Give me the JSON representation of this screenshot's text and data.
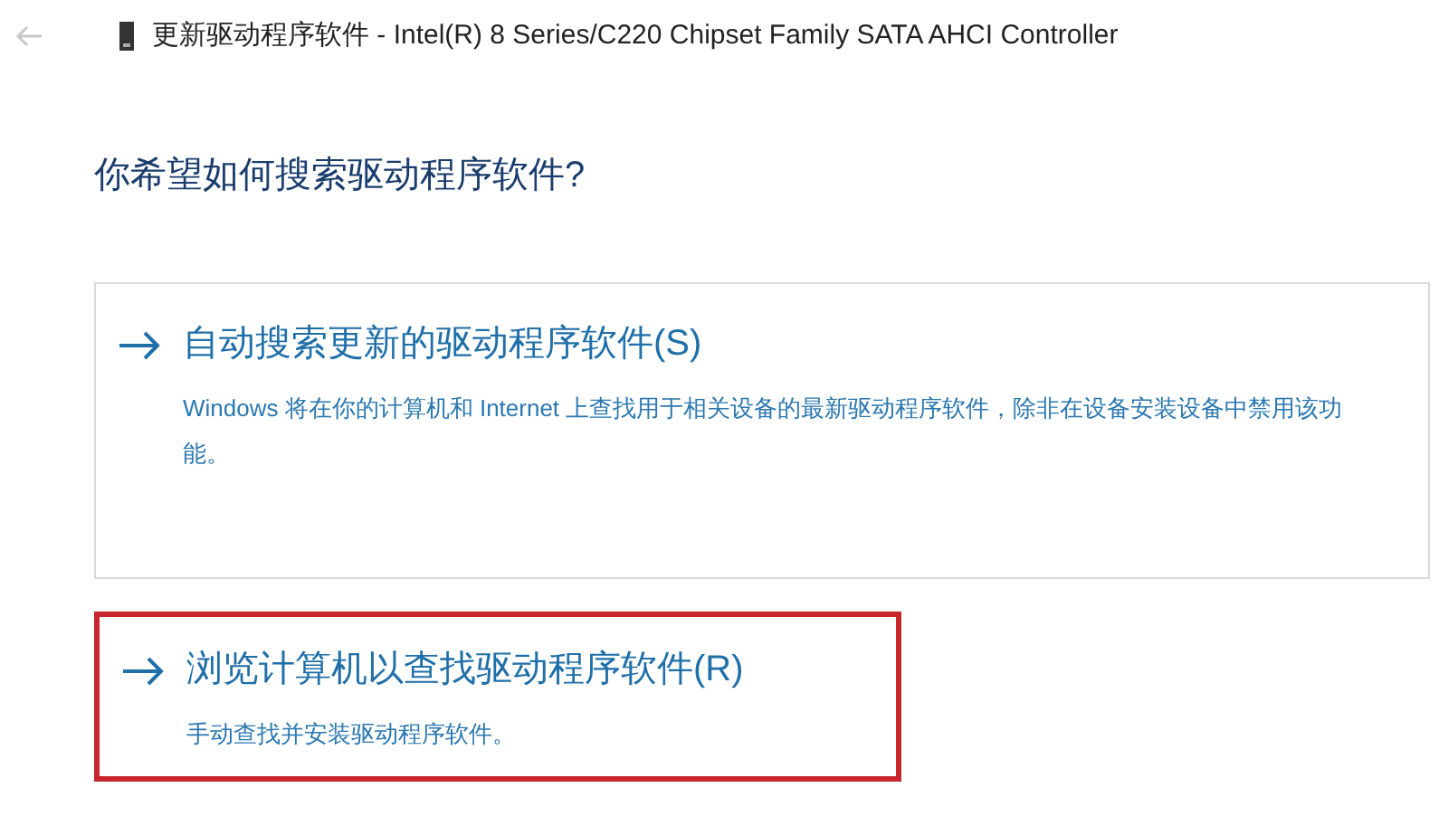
{
  "window": {
    "title": "更新驱动程序软件 - Intel(R) 8 Series/C220 Chipset Family SATA AHCI Controller"
  },
  "heading": "你希望如何搜索驱动程序软件?",
  "options": [
    {
      "title": "自动搜索更新的驱动程序软件(S)",
      "description": "Windows 将在你的计算机和 Internet 上查找用于相关设备的最新驱动程序软件，除非在设备安装设备中禁用该功能。",
      "hovered": true,
      "highlighted": false
    },
    {
      "title": "浏览计算机以查找驱动程序软件(R)",
      "description": "手动查找并安装驱动程序软件。",
      "hovered": false,
      "highlighted": true
    }
  ]
}
